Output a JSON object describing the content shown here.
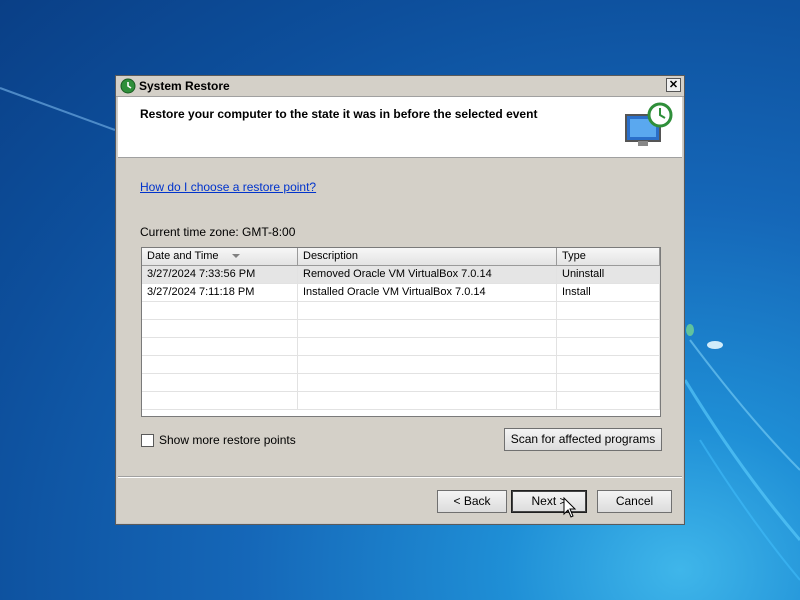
{
  "window": {
    "title": "System Restore",
    "close_label": "✕"
  },
  "header": {
    "title": "Restore your computer to the state it was in before the selected event"
  },
  "help_link": "How do I choose a restore point?",
  "timezone": "Current time zone: GMT-8:00",
  "table": {
    "columns": [
      "Date and Time",
      "Description",
      "Type"
    ],
    "rows": [
      {
        "date": "3/27/2024 7:33:56 PM",
        "description": "Removed Oracle VM VirtualBox 7.0.14",
        "type": "Uninstall",
        "selected": true
      },
      {
        "date": "3/27/2024 7:11:18 PM",
        "description": "Installed Oracle VM VirtualBox 7.0.14",
        "type": "Install",
        "selected": false
      }
    ]
  },
  "show_more_label": "Show more restore points",
  "buttons": {
    "scan": "Scan for affected programs",
    "back": "< Back",
    "next": "Next >",
    "cancel": "Cancel"
  },
  "icons": {
    "title": "system-restore-icon",
    "header": "system-restore-monitor-icon",
    "cursor": "mouse-pointer-icon"
  }
}
